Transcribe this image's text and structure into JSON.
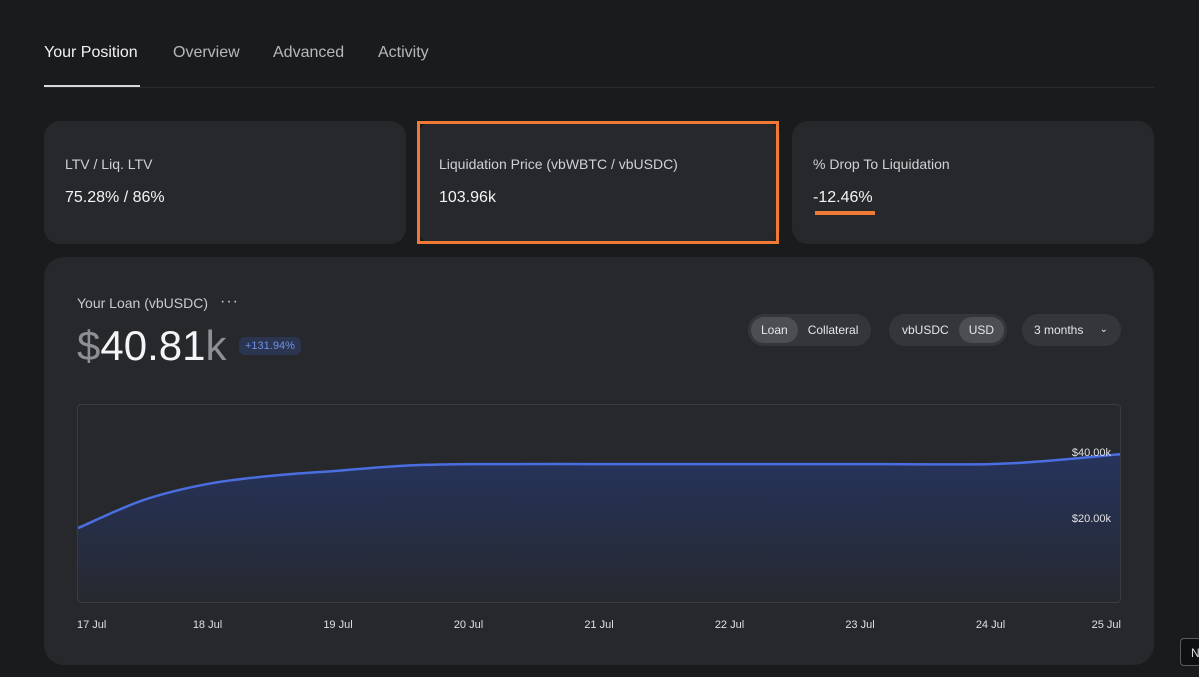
{
  "tabs": [
    {
      "label": "Your Position",
      "active": true
    },
    {
      "label": "Overview",
      "active": false
    },
    {
      "label": "Advanced",
      "active": false
    },
    {
      "label": "Activity",
      "active": false
    }
  ],
  "cards": {
    "ltv": {
      "label": "LTV / Liq. LTV",
      "value": "75.28% / 86%"
    },
    "liq_price": {
      "label": "Liquidation Price (vbWBTC / vbUSDC)",
      "value": "103.96k"
    },
    "drop": {
      "label": "% Drop To Liquidation",
      "value": "-12.46%"
    }
  },
  "highlight_color": "#ee7a36",
  "loan": {
    "title": "Your Loan (vbUSDC)",
    "more_icon": "more-horizontal-icon",
    "amount_prefix": "$",
    "amount_main": "40.81",
    "amount_suffix": "k",
    "change_badge": "+131.94%",
    "toggle_type": {
      "options": [
        "Loan",
        "Collateral"
      ],
      "selected": "Loan"
    },
    "toggle_unit": {
      "options": [
        "vbUSDC",
        "USD"
      ],
      "selected": "USD"
    },
    "range": {
      "label": "3 months",
      "icon": "chevron-down-icon"
    }
  },
  "corner_chip": "N",
  "chart_data": {
    "type": "area",
    "series_color": "#4a6ee0",
    "x": [
      "17 Jul",
      "18 Jul",
      "19 Jul",
      "20 Jul",
      "21 Jul",
      "22 Jul",
      "23 Jul",
      "24 Jul",
      "25 Jul"
    ],
    "y_tick_labels": [
      "$40.00k",
      "$20.00k"
    ],
    "y_ticks": [
      40000,
      20000
    ],
    "ylim": [
      -5000,
      55000
    ],
    "points": [
      {
        "x": 0.0,
        "y": 17500
      },
      {
        "x": 0.5,
        "y": 26000
      },
      {
        "x": 1.0,
        "y": 31000
      },
      {
        "x": 1.5,
        "y": 33500
      },
      {
        "x": 2.0,
        "y": 35000
      },
      {
        "x": 2.5,
        "y": 36500
      },
      {
        "x": 3.0,
        "y": 37000
      },
      {
        "x": 4.0,
        "y": 37000
      },
      {
        "x": 5.0,
        "y": 37000
      },
      {
        "x": 6.0,
        "y": 37000
      },
      {
        "x": 7.0,
        "y": 37000
      },
      {
        "x": 7.5,
        "y": 38200
      },
      {
        "x": 8.0,
        "y": 40000
      }
    ]
  }
}
